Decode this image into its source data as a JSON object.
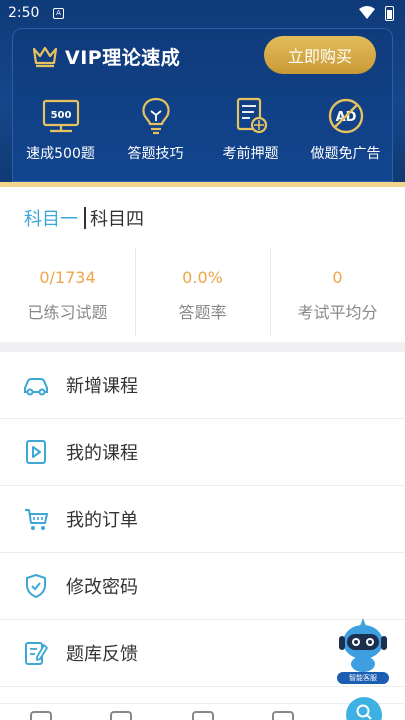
{
  "status_bar": {
    "time": "2:50",
    "notification_glyph": "A"
  },
  "vip": {
    "title": "VIP理论速成",
    "buy_button": "立即购买",
    "items": [
      {
        "label": "速成500题",
        "icon": "monitor-500-icon",
        "icon_text": "500"
      },
      {
        "label": "答题技巧",
        "icon": "lightbulb-icon"
      },
      {
        "label": "考前押题",
        "icon": "exam-paper-icon"
      },
      {
        "label": "做题免广告",
        "icon": "no-ad-icon",
        "icon_text": "AD"
      }
    ]
  },
  "subject_tabs": {
    "active": "科目一",
    "other": "科目四"
  },
  "stats": [
    {
      "value": "0/1734",
      "label": "已练习试题"
    },
    {
      "value": "0.0%",
      "label": "答题率"
    },
    {
      "value": "0",
      "label": "考试平均分"
    }
  ],
  "menu": [
    {
      "label": "新增课程",
      "icon": "car-icon"
    },
    {
      "label": "我的课程",
      "icon": "play-video-icon"
    },
    {
      "label": "我的订单",
      "icon": "cart-icon"
    },
    {
      "label": "修改密码",
      "icon": "shield-check-icon"
    },
    {
      "label": "题库反馈",
      "icon": "feedback-pen-icon"
    }
  ],
  "robot": {
    "label": "智能客服"
  },
  "colors": {
    "header_blue": "#12458f",
    "gold": "#d4a843",
    "accent_blue": "#3da7d6",
    "stat_orange": "#f0a54a"
  }
}
